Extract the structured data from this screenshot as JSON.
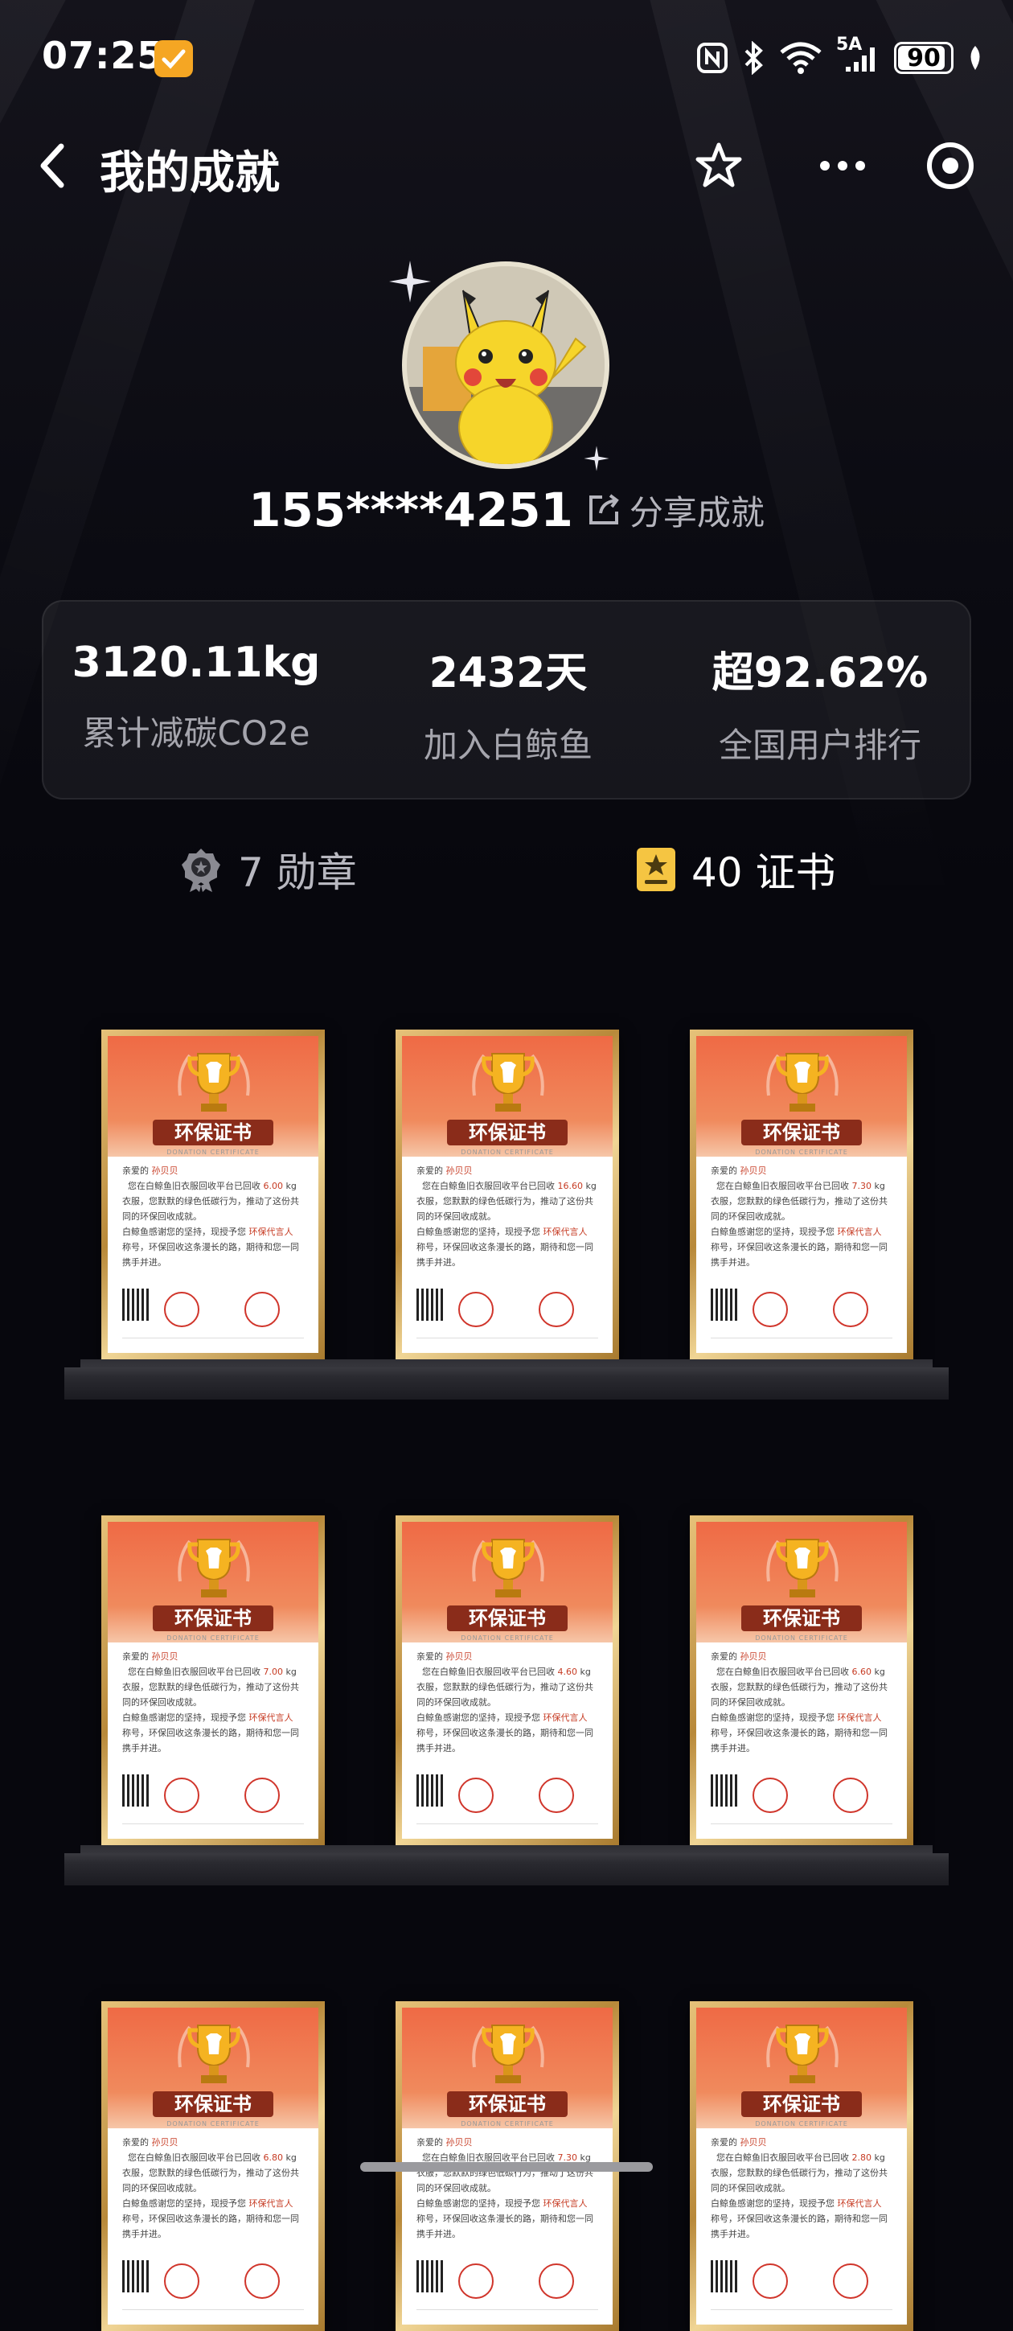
{
  "status_bar": {
    "time": "07:25",
    "network": "5A",
    "battery": "90"
  },
  "nav": {
    "title": "我的成就"
  },
  "profile": {
    "username": "155****4251",
    "share_label": "分享成就"
  },
  "stats": [
    {
      "value": "3120.11kg",
      "label": "累计减碳CO2e"
    },
    {
      "value": "2432天",
      "label": "加入白鲸鱼"
    },
    {
      "value": "超92.62%",
      "label": "全国用户排行"
    }
  ],
  "tabs": {
    "medals": "7 勋章",
    "certificates": "40 证书"
  },
  "certificate": {
    "title": "环保证书",
    "subtitle": "DONATION CERTIFICATE",
    "greeting": "亲爱的",
    "name": "孙贝贝",
    "line_1": "您在白鲸鱼旧衣服回收平台已回收",
    "unit": "kg",
    "line_2": "衣服，您默默的绿色低碳行为，推动了这份共同的环保回收成就。",
    "line_3": "白鲸鱼感谢您的坚持，现授予您",
    "award": "环保代言人",
    "line_4": "称号，环保回收这条漫长的路，期待和您一同携手并进。"
  },
  "certificates": [
    {
      "amount": "6.00"
    },
    {
      "amount": "16.60"
    },
    {
      "amount": "7.30"
    },
    {
      "amount": "7.00"
    },
    {
      "amount": "4.60"
    },
    {
      "amount": "6.60"
    },
    {
      "amount": "6.80"
    },
    {
      "amount": "7.30"
    },
    {
      "amount": "2.80"
    }
  ]
}
